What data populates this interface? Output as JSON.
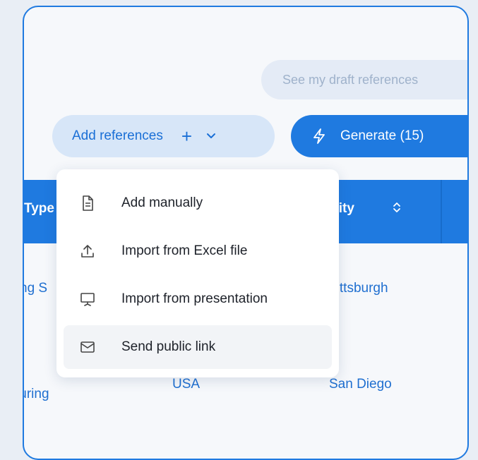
{
  "toolbar": {
    "draft_label": "See my draft references",
    "add_label": "Add references",
    "add_plus": "+",
    "generate_label": "Generate (15)"
  },
  "table": {
    "headers": {
      "type": "Type",
      "city": "City",
      "sort_icon": "sort-icon"
    },
    "rows": [
      {
        "type": "ng S",
        "city": "Pittsburgh"
      },
      {
        "type": "turing",
        "country": "USA",
        "city": "San Diego"
      }
    ]
  },
  "menu": {
    "items": [
      {
        "label": "Add manually",
        "icon": "document-icon"
      },
      {
        "label": "Import from Excel file",
        "icon": "upload-icon"
      },
      {
        "label": "Import from presentation",
        "icon": "presentation-icon"
      },
      {
        "label": "Send public link",
        "icon": "mail-icon"
      }
    ]
  },
  "colors": {
    "accent": "#1f7ae0",
    "pale_blue": "#d7e6f8",
    "link_text": "#1f6fd0"
  }
}
